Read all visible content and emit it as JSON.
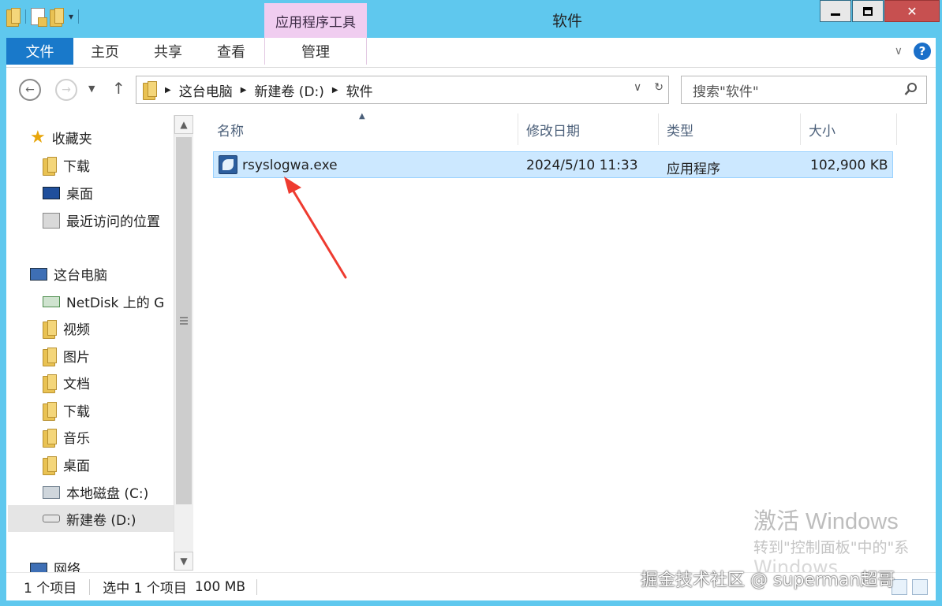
{
  "window": {
    "title": "软件",
    "contextual_tab_group": "应用程序工具",
    "close_glyph": "✕"
  },
  "ribbon": {
    "tabs": [
      "文件",
      "主页",
      "共享",
      "查看",
      "管理"
    ],
    "collapse_glyph": "∨",
    "help_glyph": "?"
  },
  "address": {
    "breadcrumbs": [
      "这台电脑",
      "新建卷 (D:)",
      "软件"
    ],
    "search_placeholder": "搜索\"软件\""
  },
  "navigation": {
    "favorites": {
      "header": "收藏夹",
      "items": [
        "下载",
        "桌面",
        "最近访问的位置"
      ]
    },
    "this_pc": {
      "header": "这台电脑",
      "items": [
        "NetDisk 上的 G",
        "视频",
        "图片",
        "文档",
        "下载",
        "音乐",
        "桌面",
        "本地磁盘 (C:)",
        "新建卷 (D:)"
      ]
    },
    "network": "网络",
    "selected": "新建卷 (D:)"
  },
  "columns": [
    "名称",
    "修改日期",
    "类型",
    "大小"
  ],
  "files": [
    {
      "name": "rsyslogwa.exe",
      "modified": "2024/5/10 11:33",
      "type": "应用程序",
      "size": "102,900 KB",
      "selected": true
    }
  ],
  "status": {
    "item_count": "1 个项目",
    "selected_info": "选中 1 个项目",
    "selected_size": "100 MB"
  },
  "overlays": {
    "activation_title": "激活 Windows",
    "activation_hint": "转到\"控制面板\"中的\"系",
    "activation_line3": "Windows",
    "site_watermark": "掘金技术社区 @ superman超哥",
    "annotation_arrow_color": "#ee3b30"
  },
  "colors": {
    "titlebar": "#5fc8ee",
    "file_tab": "#1979ca",
    "contextual_tab": "#f0cdf0",
    "selection": "#cce8ff",
    "close_button": "#c75050"
  }
}
